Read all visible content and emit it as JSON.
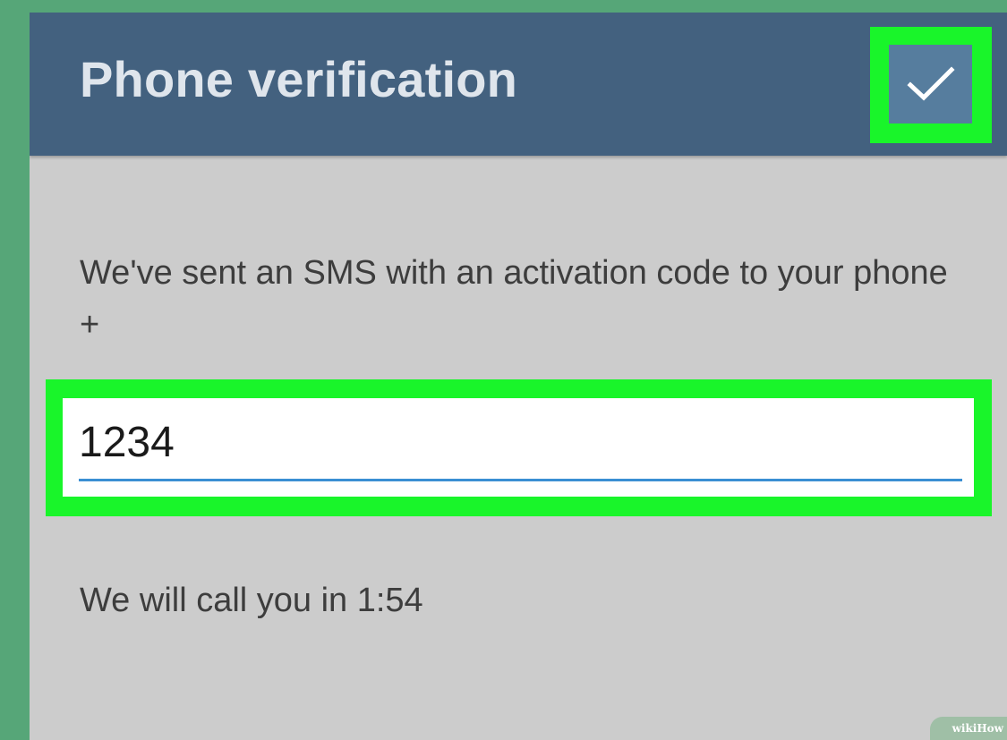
{
  "header": {
    "title": "Phone verification",
    "confirm_icon": "check-icon"
  },
  "message": {
    "text": "We've sent an SMS with an activation code to your phone +"
  },
  "code_input": {
    "value": "1234"
  },
  "call_notice": {
    "text": "We will call you in 1:54"
  },
  "watermark": {
    "text": "wikiHow"
  },
  "colors": {
    "header_bg": "#43617f",
    "content_bg": "#cccccc",
    "highlight": "#19f52a",
    "outer_bg": "#56a678",
    "input_underline": "#3a8fd3"
  }
}
